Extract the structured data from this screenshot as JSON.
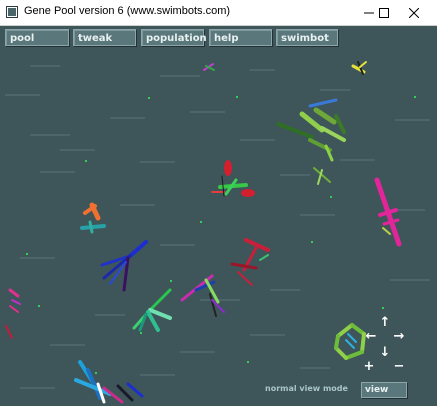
{
  "window": {
    "title": "Gene Pool version 6   (www.swimbots.com)",
    "controls": [
      "minimize",
      "maximize",
      "close"
    ]
  },
  "menu": {
    "items": [
      {
        "label": "pool"
      },
      {
        "label": "tweak"
      },
      {
        "label": "population"
      },
      {
        "label": "help"
      },
      {
        "label": "swimbot"
      }
    ]
  },
  "status": {
    "mode_label": "normal view mode",
    "view_button": "view"
  },
  "navigation": {
    "icons": [
      "arrow-up-icon",
      "arrow-left-icon",
      "arrow-right-icon",
      "arrow-down-icon",
      "zoom-in-icon",
      "zoom-out-icon"
    ],
    "plus": "+",
    "minus": "−"
  },
  "colors": {
    "background": "#3e5559",
    "button_fill": "#5a777c",
    "button_text": "#e8f0f0",
    "status_text": "#a9c6c8",
    "food": "#2fd05a"
  }
}
